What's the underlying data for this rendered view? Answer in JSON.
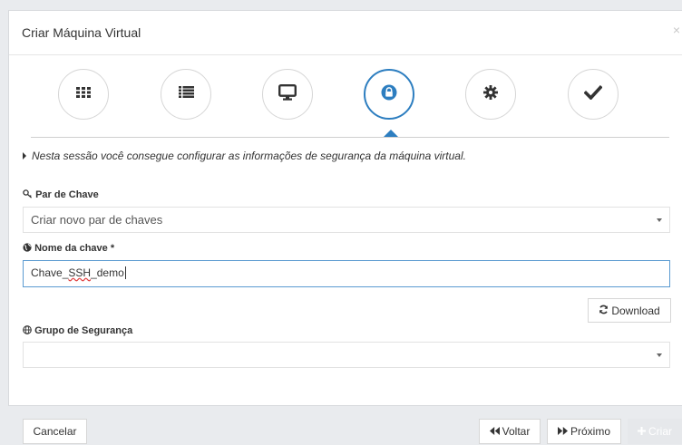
{
  "modal": {
    "title": "Criar Máquina Virtual",
    "close_label": "×"
  },
  "wizard": {
    "steps": [
      {
        "icon": "grid-icon",
        "active": false
      },
      {
        "icon": "list-icon",
        "active": false
      },
      {
        "icon": "monitor-icon",
        "active": false
      },
      {
        "icon": "lock-icon",
        "active": true
      },
      {
        "icon": "gear-icon",
        "active": false
      },
      {
        "icon": "check-icon",
        "active": false
      }
    ],
    "accent": "#2d7ec0"
  },
  "intro_text": "Nesta sessão você consegue configurar as informações de segurança da máquina virtual.",
  "key_pair": {
    "label": "Par de Chave",
    "selected": "Criar novo par de chaves"
  },
  "key_name": {
    "label": "Nome da chave *",
    "value_prefix": "Chave_",
    "value_misspelled": "SSH",
    "value_suffix": "_demo"
  },
  "download_label": "Download",
  "security_group": {
    "label": "Grupo de Segurança",
    "selected": ""
  },
  "footer": {
    "cancel_label": "Cancelar",
    "back_label": "Voltar",
    "next_label": "Próximo",
    "create_label": "Criar"
  }
}
